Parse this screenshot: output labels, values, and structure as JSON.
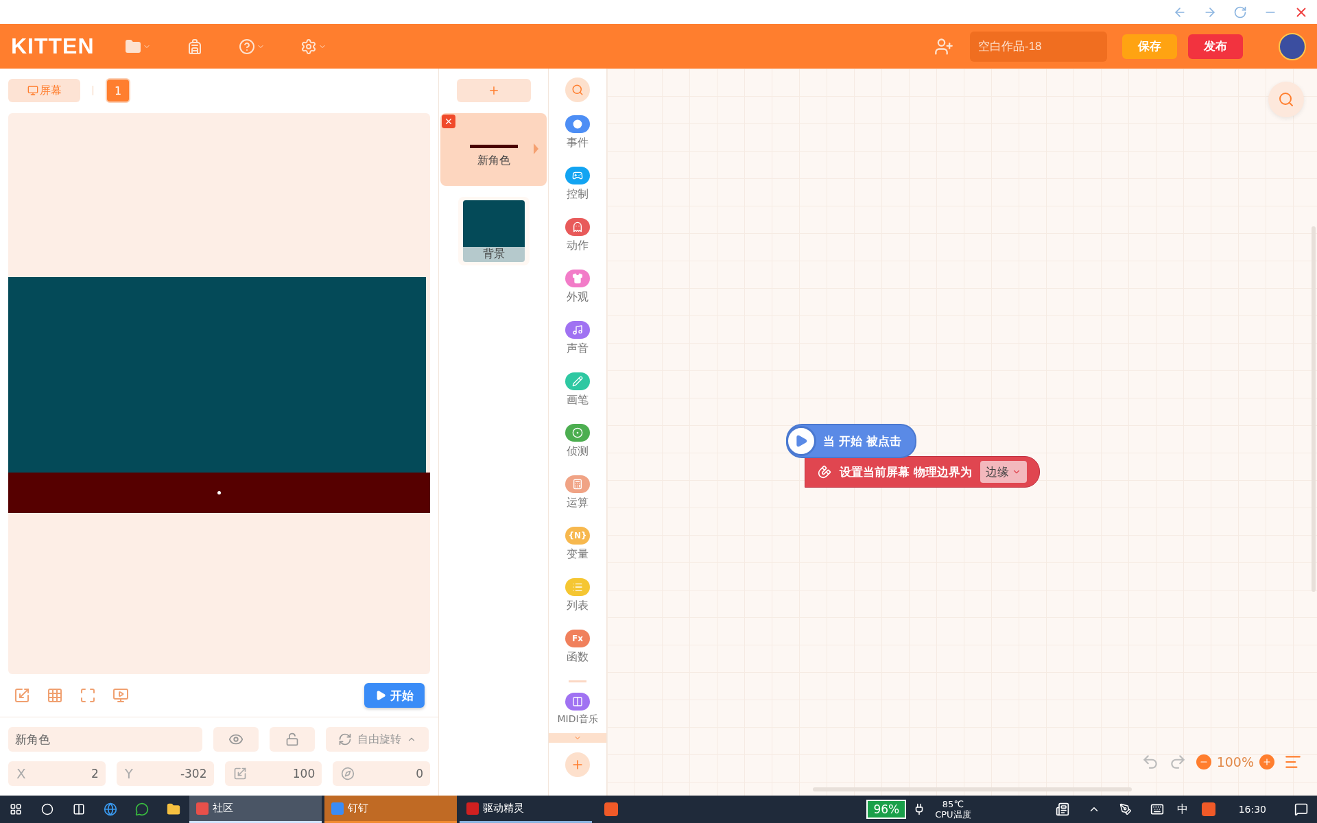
{
  "header": {
    "logo": "KITTEN",
    "project_name": "空白作品-18",
    "buttons": [
      {
        "label": "保存",
        "kind": "save"
      },
      {
        "label": "发布",
        "kind": "publish"
      }
    ]
  },
  "stage_tabs": {
    "screen_tab": "屏幕",
    "pages": [
      {
        "label": "1",
        "selected": true
      }
    ]
  },
  "stage": {
    "start_button": "开始"
  },
  "sprite_props": {
    "name": "新角色",
    "rotation": "自由旋转",
    "fields": [
      {
        "kind": "x",
        "label": "X",
        "value": "2"
      },
      {
        "kind": "y",
        "label": "Y",
        "value": "-302"
      },
      {
        "kind": "size",
        "value": "100"
      },
      {
        "kind": "direction",
        "value": "0"
      }
    ]
  },
  "sprites": [
    {
      "label": "新角色",
      "kind": "sprite",
      "selected": true
    },
    {
      "label": "背景",
      "kind": "background",
      "selected": false
    }
  ],
  "categories": [
    {
      "label": "事件",
      "color": "#4d8ef5"
    },
    {
      "label": "控制",
      "color": "#12a4f2"
    },
    {
      "label": "动作",
      "color": "#e85a5a"
    },
    {
      "label": "外观",
      "color": "#f27cc8"
    },
    {
      "label": "声音",
      "color": "#a072f2"
    },
    {
      "label": "画笔",
      "color": "#2ec8a2"
    },
    {
      "label": "侦测",
      "color": "#4cae50"
    },
    {
      "label": "运算",
      "color": "#f0a385"
    },
    {
      "label": "变量",
      "color": "#f7b84e",
      "icon_text": "{N}"
    },
    {
      "label": "列表",
      "color": "#f5c632"
    },
    {
      "label": "函数",
      "color": "#f0805c",
      "icon_text": "Fx"
    },
    {
      "label": "MIDI音乐",
      "color": "#a072f2"
    }
  ],
  "blocks": [
    {
      "kind": "hat",
      "text": "当 开始 被点击"
    },
    {
      "kind": "command",
      "text": "设置当前屏幕 物理边界为",
      "dropdown": "边缘"
    }
  ],
  "zoom": "100%",
  "taskbar": {
    "apps": [
      {
        "label": "社区",
        "selected": true,
        "attention": false
      },
      {
        "label": "钉钉",
        "selected": false,
        "attention": true
      },
      {
        "label": "驱动精灵",
        "selected": false,
        "attention": false
      }
    ],
    "battery": "96%",
    "temperature": "85℃",
    "temperature_label": "CPU温度",
    "input_method": "中",
    "time": "16:30"
  }
}
